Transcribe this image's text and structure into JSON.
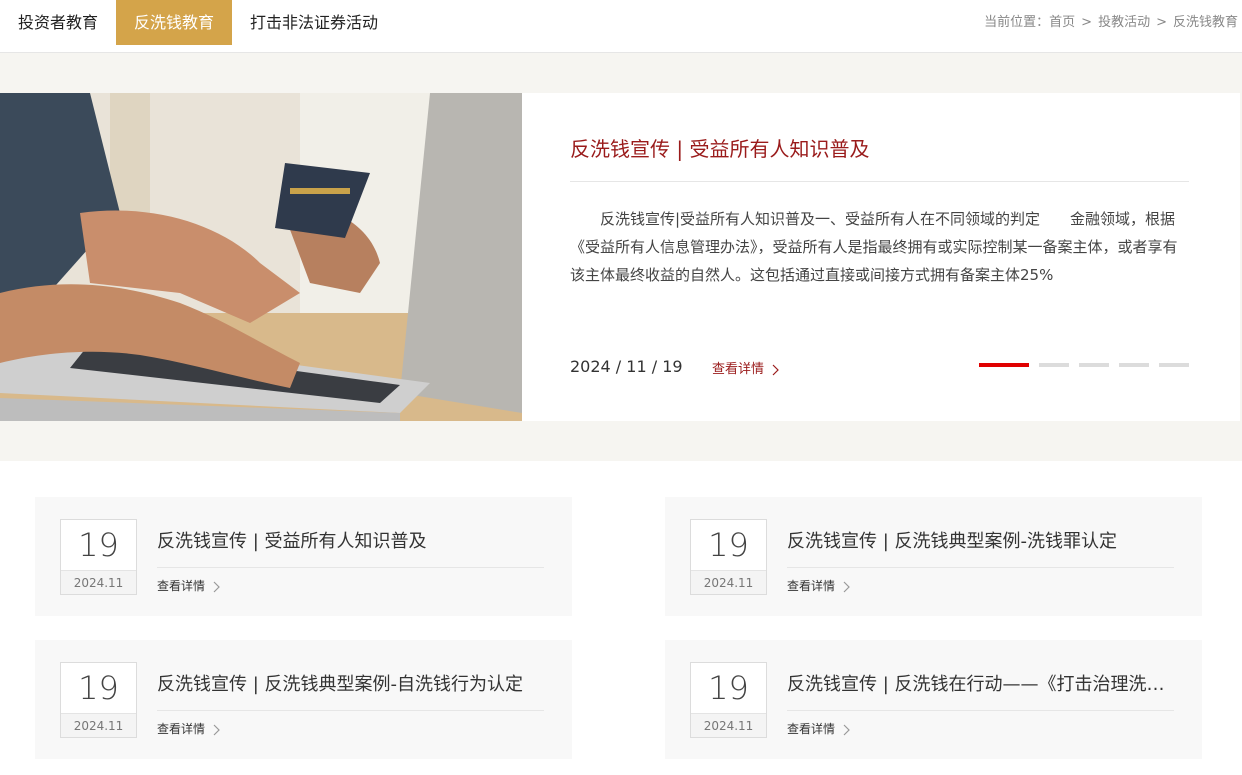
{
  "nav": {
    "tabs": [
      {
        "label": "投资者教育"
      },
      {
        "label": "反洗钱教育"
      },
      {
        "label": "打击非法证券活动"
      }
    ],
    "breadcrumb": {
      "prefix": "当前位置：",
      "items": [
        "首页",
        "投教活动",
        "反洗钱教育"
      ],
      "separator": ">"
    }
  },
  "banner": {
    "title": "反洗钱宣传 | 受益所有人知识普及",
    "text": "反洗钱宣传|受益所有人知识普及一、受益所有人在不同领域的判定　　金融领域，根据《受益所有人信息管理办法》，受益所有人是指最终拥有或实际控制某一备案主体，或者享有该主体最终收益的自然人。这包括通过直接或间接方式拥有备案主体25%",
    "date": "2024 / 11 / 19",
    "more_label": "查看详情",
    "slides": 5,
    "active_slide": 1
  },
  "colors": {
    "accent": "#d4a44a",
    "title_red": "#9a1b1b",
    "dot_active": "#e00000",
    "band_bg": "#f6f5f1"
  },
  "cards": [
    {
      "day": "19",
      "ym": "2024.11",
      "title": "反洗钱宣传 | 受益所有人知识普及",
      "more": "查看详情"
    },
    {
      "day": "19",
      "ym": "2024.11",
      "title": "反洗钱宣传 | 反洗钱典型案例-洗钱罪认定",
      "more": "查看详情"
    },
    {
      "day": "19",
      "ym": "2024.11",
      "title": "反洗钱宣传 | 反洗钱典型案例-自洗钱行为认定",
      "more": "查看详情"
    },
    {
      "day": "19",
      "ym": "2024.11",
      "title": "反洗钱宣传 | 反洗钱在行动——《打击治理洗…",
      "more": "查看详情"
    }
  ]
}
